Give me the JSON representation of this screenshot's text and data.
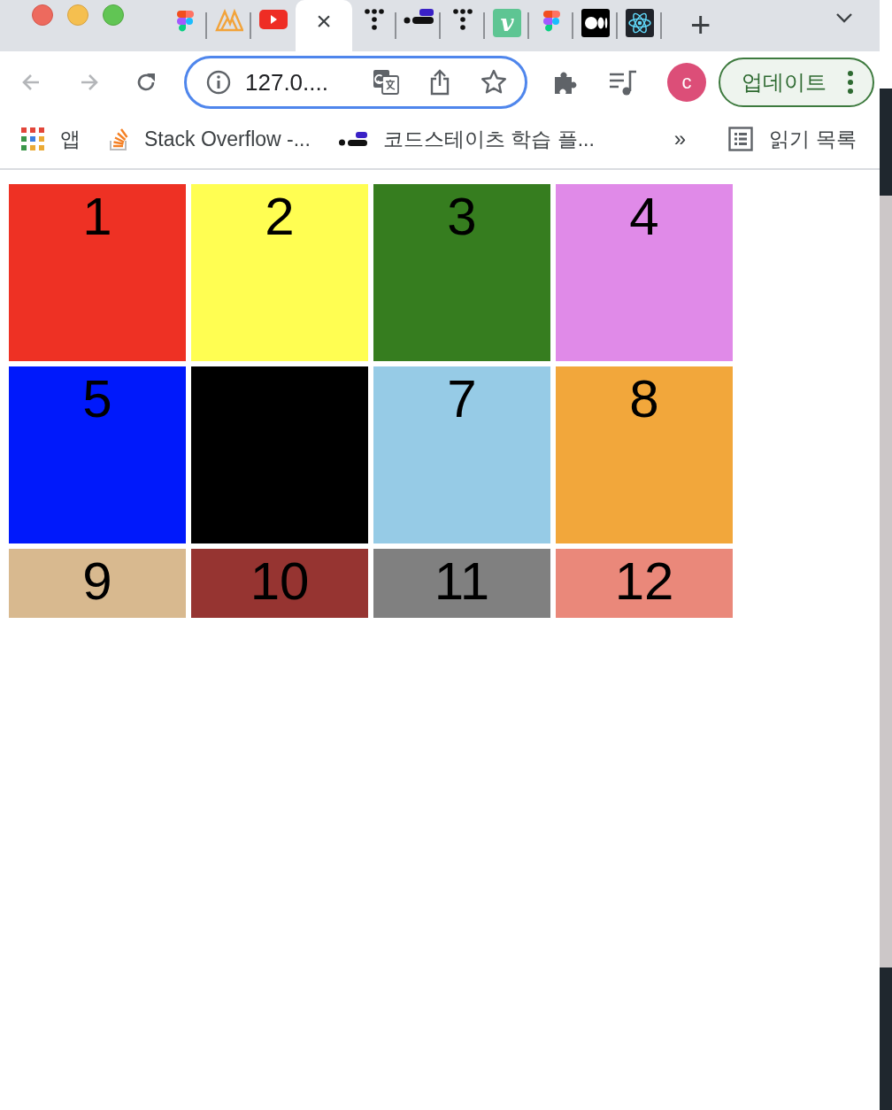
{
  "tabs": [
    {
      "kind": "figma",
      "selected": false
    },
    {
      "kind": "peaks",
      "selected": false
    },
    {
      "kind": "youtube",
      "selected": false
    },
    {
      "kind": "blank",
      "selected": true,
      "close": "×"
    },
    {
      "kind": "dots",
      "selected": false
    },
    {
      "kind": "dash",
      "selected": false
    },
    {
      "kind": "dots",
      "selected": false
    },
    {
      "kind": "letter",
      "label": "v",
      "selected": false
    },
    {
      "kind": "figma",
      "selected": false
    },
    {
      "kind": "medium",
      "selected": false
    },
    {
      "kind": "react",
      "selected": false
    }
  ],
  "new_tab": "+",
  "nav_buttons": [
    {
      "kind": "back",
      "disabled": true
    },
    {
      "kind": "forward",
      "disabled": true
    },
    {
      "kind": "reload",
      "disabled": false
    }
  ],
  "address_bar": {
    "value": "127.0...."
  },
  "profile": {
    "initial": "c"
  },
  "update_button": {
    "label": "업데이트"
  },
  "bookmarks": [
    {
      "kind": "apps",
      "label": "앱"
    },
    {
      "kind": "stack",
      "label": "Stack Overflow -..."
    },
    {
      "kind": "dash",
      "label": "코드스테이츠 학습 플..."
    }
  ],
  "bookmarks_more": "»",
  "reading_list": {
    "label": "읽기 목록"
  },
  "grid": [
    {
      "label": "1",
      "color": "#ee3124"
    },
    {
      "label": "2",
      "color": "#fffe52"
    },
    {
      "label": "3",
      "color": "#367d1f"
    },
    {
      "label": "4",
      "color": "#e08ae8"
    },
    {
      "label": "5",
      "color": "#0019fb"
    },
    {
      "color": "#000000"
    },
    {
      "label": "7",
      "color": "#96cbe6"
    },
    {
      "label": "8",
      "color": "#f2a73b"
    },
    {
      "label": "9",
      "color": "#d8b98f"
    },
    {
      "label": "10",
      "color": "#963431"
    },
    {
      "label": "11",
      "color": "#808080"
    },
    {
      "label": "12",
      "color": "#ea887a"
    }
  ]
}
